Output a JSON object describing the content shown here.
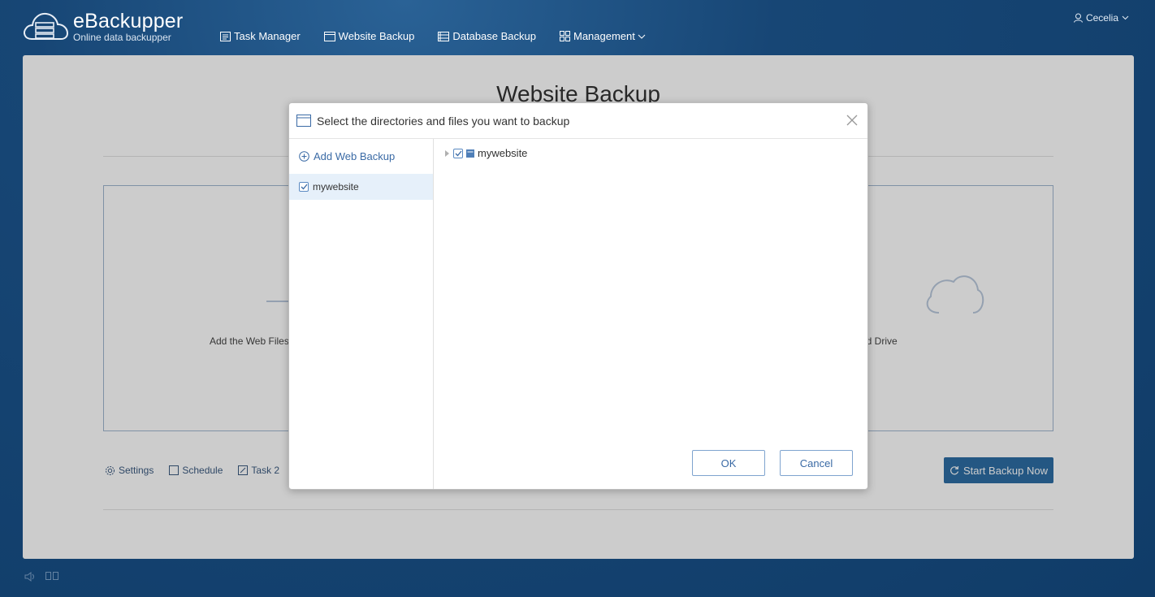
{
  "header": {
    "app_name": "eBackupper",
    "tagline": "Online data backupper",
    "nav": [
      {
        "label": "Task Manager",
        "icon": "task-list-icon"
      },
      {
        "label": "Website Backup",
        "icon": "browser-window-icon"
      },
      {
        "label": "Database Backup",
        "icon": "database-icon"
      },
      {
        "label": "Management",
        "icon": "grid-icon"
      }
    ],
    "user": "Cecelia"
  },
  "main": {
    "title": "Website Backup",
    "source_label": "Add the Web Files",
    "destination_label": "ud Drive",
    "toolbar": {
      "settings": "Settings",
      "schedule": "Schedule",
      "task": "Task 2"
    },
    "start_button": "Start Backup Now"
  },
  "dialog": {
    "title": "Select the directories and files you want to backup",
    "add_web_backup": "Add Web Backup",
    "sites": [
      "mywebsite"
    ],
    "tree_root": "mywebsite",
    "ok": "OK",
    "cancel": "Cancel"
  },
  "colors": {
    "brand_dark": "#103c68",
    "accent": "#2e6da4",
    "link": "#3a6aa5"
  }
}
